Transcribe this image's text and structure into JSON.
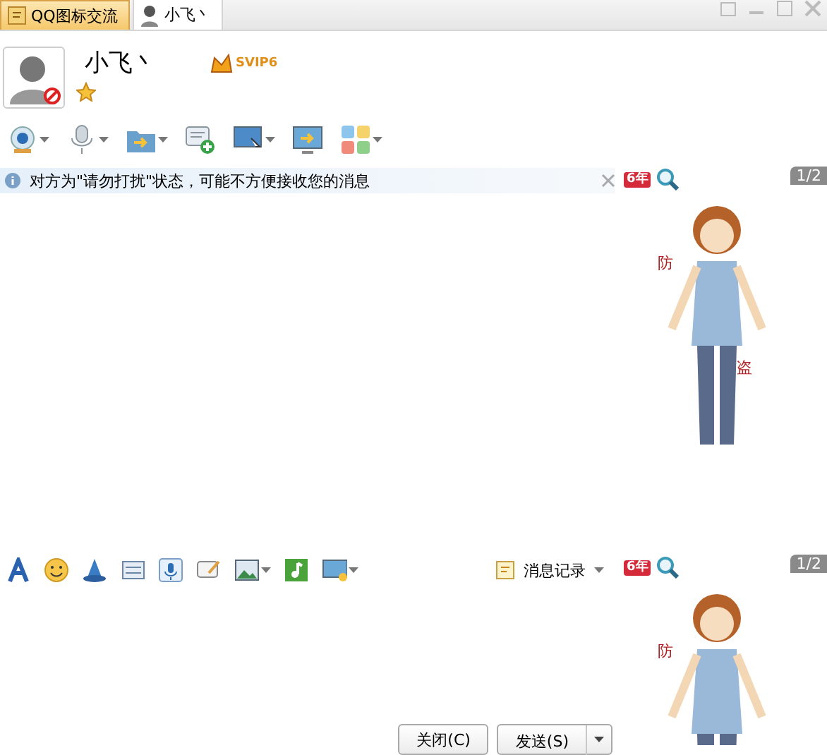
{
  "tabs": [
    {
      "label": "QQ图标交流",
      "selected": false
    },
    {
      "label": "小飞丶",
      "selected": true
    }
  ],
  "contact": {
    "name": "小飞丶",
    "vip": "SVIP6"
  },
  "notice": "对方为\"请勿打扰\"状态，可能不方便接收您的消息",
  "history_button": "消息记录",
  "show_panels": [
    {
      "badge": "6年",
      "page": "1/2",
      "marks": [
        "防",
        "盗"
      ]
    },
    {
      "badge": "6年",
      "page": "1/2",
      "marks": [
        "防"
      ]
    }
  ],
  "buttons": [
    {
      "label": "关闭(C)"
    },
    {
      "label": "发送(S)"
    }
  ]
}
